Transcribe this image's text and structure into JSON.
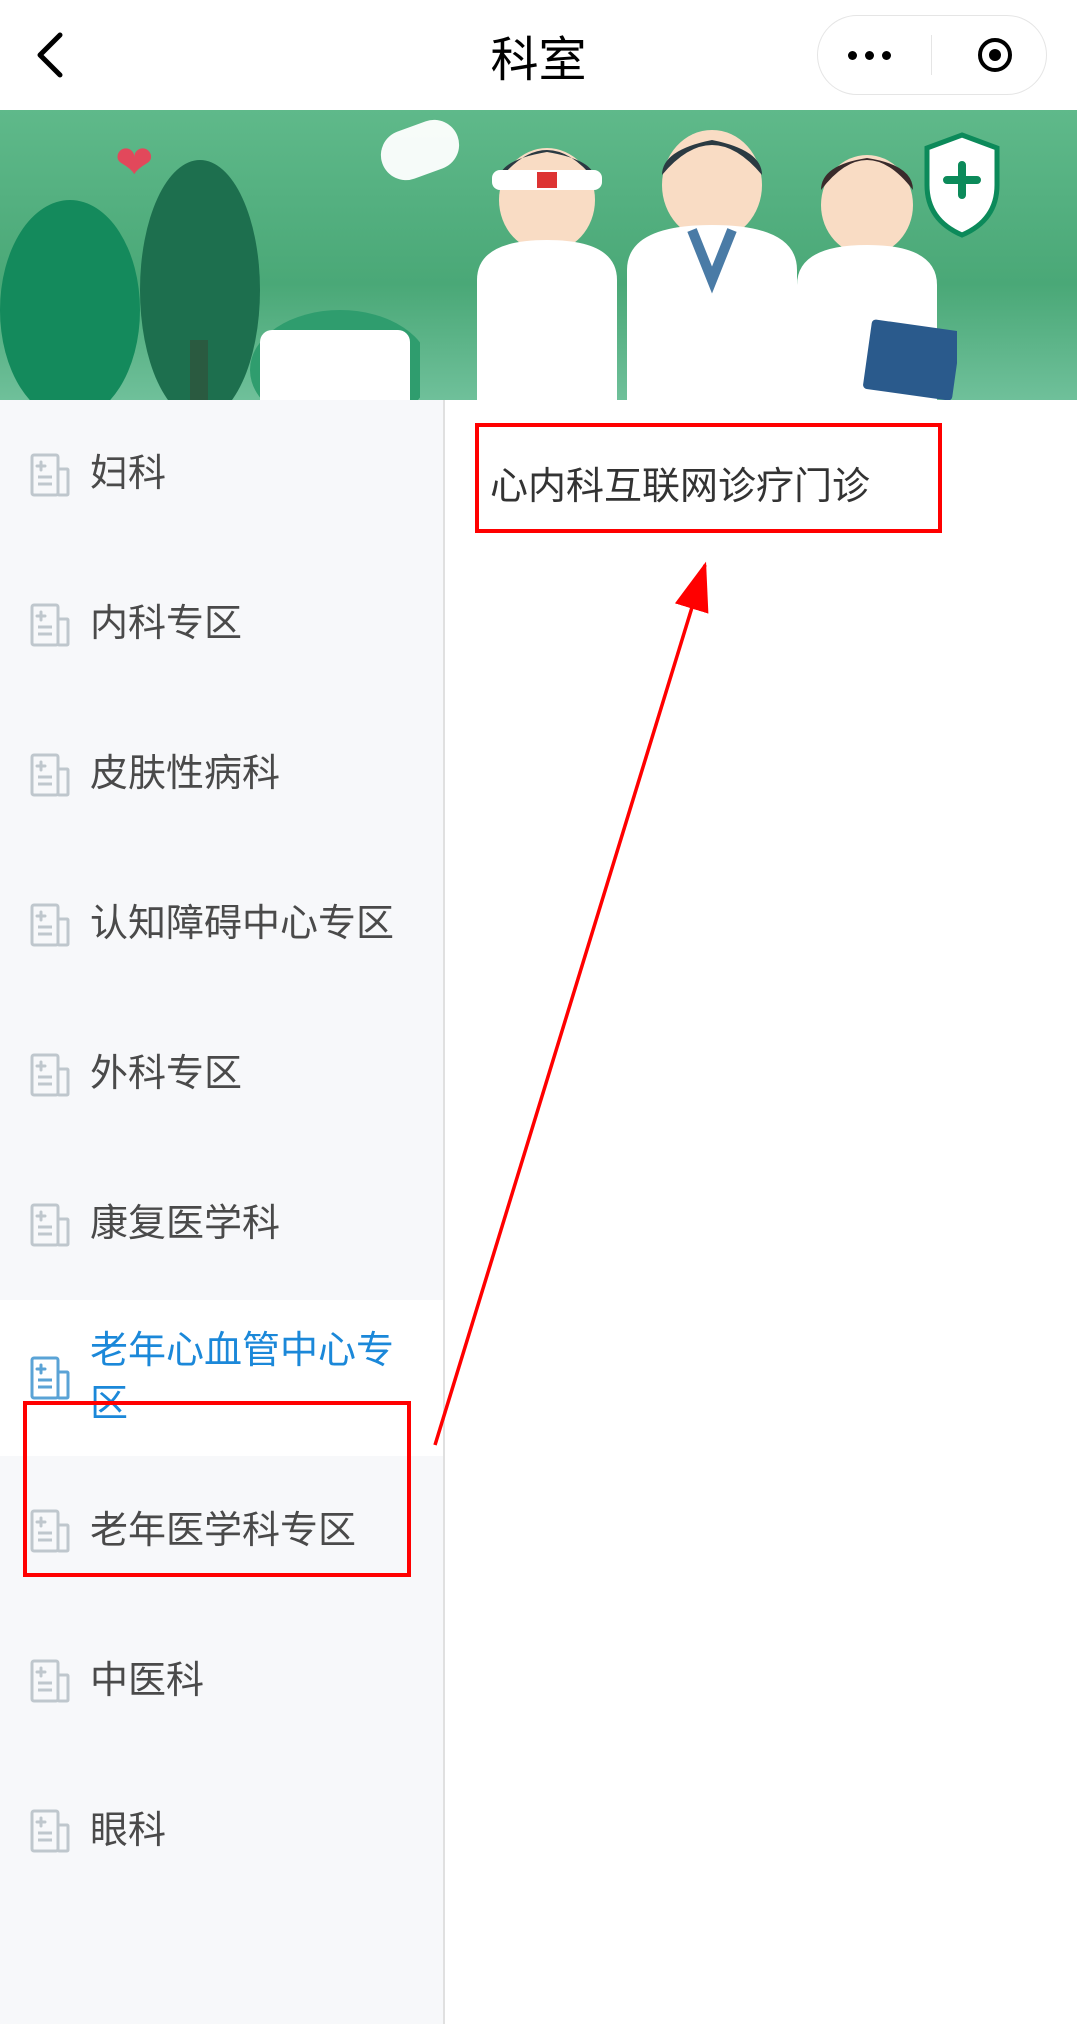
{
  "header": {
    "title": "科室"
  },
  "sidebar": {
    "items": [
      {
        "label": "妇科",
        "active": false
      },
      {
        "label": "内科专区",
        "active": false
      },
      {
        "label": "皮肤性病科",
        "active": false
      },
      {
        "label": "认知障碍中心专区",
        "active": false
      },
      {
        "label": "外科专区",
        "active": false
      },
      {
        "label": "康复医学科",
        "active": false
      },
      {
        "label": "老年心血管中心专区",
        "active": true
      },
      {
        "label": "老年医学科专区",
        "active": false
      },
      {
        "label": "中医科",
        "active": false
      },
      {
        "label": "眼科",
        "active": false
      }
    ]
  },
  "main": {
    "clinics": [
      {
        "label": "心内科互联网诊疗门诊"
      }
    ]
  },
  "annotations": {
    "highlighted_sidebar_index": 6,
    "highlighted_clinic_index": 0
  },
  "colors": {
    "accent": "#1b88d9",
    "highlight": "#ff0000",
    "banner_bg": "#5fb98a",
    "sidebar_bg": "#f7f8fa",
    "icon_gray": "#bfc7cd",
    "icon_active": "#5aa3d6"
  }
}
